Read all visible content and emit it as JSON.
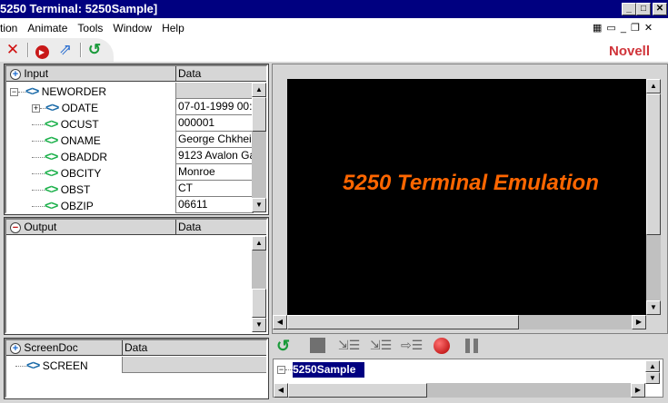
{
  "window": {
    "title": "5250 Terminal: 5250Sample]",
    "min": "_",
    "max": "□",
    "close": "✕"
  },
  "menu": [
    "tion",
    "Animate",
    "Tools",
    "Window",
    "Help"
  ],
  "mdi": {
    "tile": "▦",
    "cascade": "▭",
    "min": "_",
    "restore": "❐",
    "close": "✕"
  },
  "brand": "Novell",
  "brand_color": "#d0343a",
  "input_panel": {
    "title": "Input",
    "data_col": "Data",
    "root": "NEWORDER",
    "rows": [
      {
        "name": "ODATE",
        "value": "07-01-1999 00:"
      },
      {
        "name": "OCUST",
        "value": "000001"
      },
      {
        "name": "ONAME",
        "value": "George Chkhei"
      },
      {
        "name": "OBADDR",
        "value": "9123 Avalon Ga"
      },
      {
        "name": "OBCITY",
        "value": "Monroe"
      },
      {
        "name": "OBST",
        "value": "CT"
      },
      {
        "name": "OBZIP",
        "value": "06611"
      }
    ]
  },
  "output_panel": {
    "title": "Output",
    "data_col": "Data"
  },
  "screendoc_panel": {
    "title": "ScreenDoc",
    "data_col": "Data",
    "root": "SCREEN"
  },
  "terminal": {
    "text": "5250 Terminal Emulation",
    "text_color": "#ff6600"
  },
  "tree": {
    "root": "5250Sample"
  }
}
